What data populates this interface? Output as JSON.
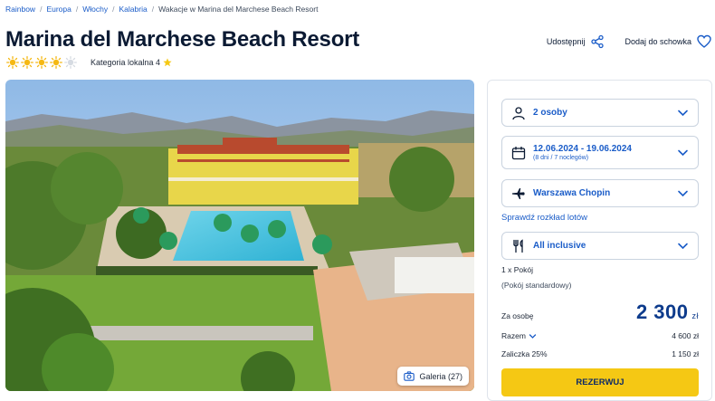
{
  "breadcrumb": [
    "Rainbow",
    "Europa",
    "Włochy",
    "Kalabria",
    "Wakacje w Marina del Marchese Beach Resort"
  ],
  "hotel": {
    "name": "Marina del Marchese Beach Resort",
    "suns_rating": 4,
    "suns_max": 5,
    "category_label": "Kategoria lokalna 4"
  },
  "actions": {
    "share": "Udostępnij",
    "favorite": "Dodaj do schowka"
  },
  "gallery": {
    "label": "Galeria (27)"
  },
  "booking": {
    "persons": "2 osoby",
    "dates": "12.06.2024 - 19.06.2024",
    "dates_sub": "(8 dni / 7 noclegów)",
    "airport": "Warszawa Chopin",
    "schedule_link": "Sprawdź rozkład lotów",
    "board": "All inclusive",
    "room_count": "1 x Pokój",
    "room_type": "(Pokój standardowy)",
    "per_person_label": "Za osobę",
    "per_person_price": "2 300",
    "currency": "zł",
    "total_label": "Razem",
    "total_value": "4 600 zł",
    "deposit_label": "Zaliczka 25%",
    "deposit_value": "1 150 zł",
    "book_label": "REZERWUJ"
  },
  "colors": {
    "accent": "#1a5cc8",
    "button": "#f5c814",
    "price": "#0d3b8c",
    "sun": "#f5b814"
  }
}
